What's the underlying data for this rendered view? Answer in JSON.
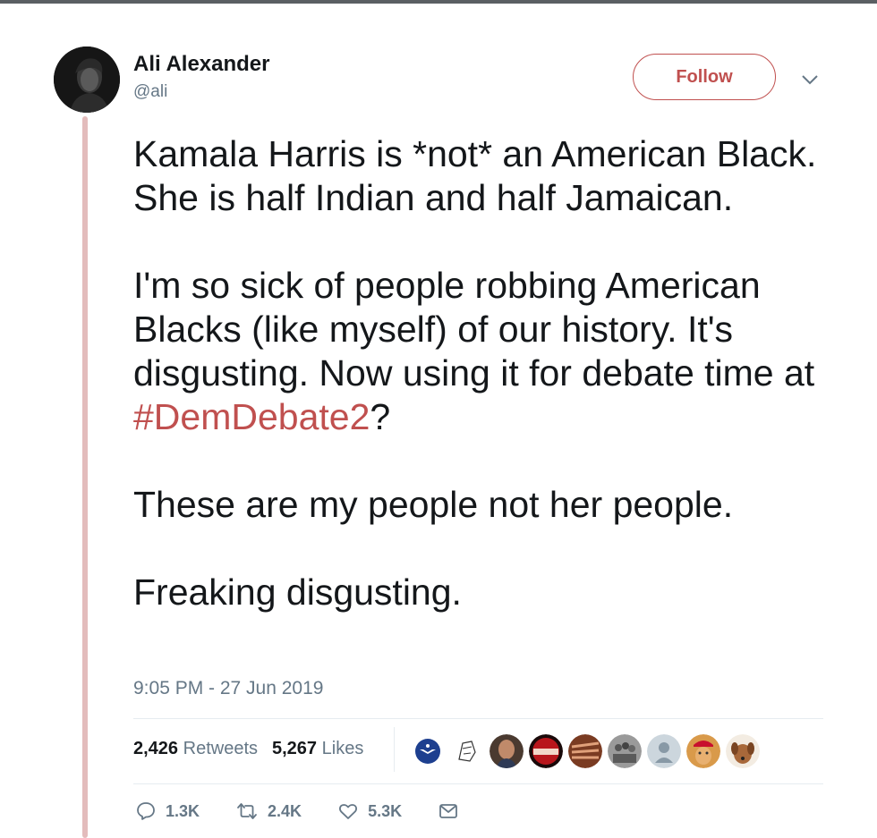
{
  "tweet": {
    "author_name": "Ali Alexander",
    "author_handle": "@ali",
    "follow_label": "Follow",
    "paragraphs": [
      {
        "text": "Kamala Harris is *not* an American Black. She is half Indian and half Jamaican."
      },
      {
        "pre": "I'm so sick of people robbing American Blacks (like myself) of our history. It's disgusting. Now using it for debate time at ",
        "hashtag": "#DemDebate2",
        "post": "?"
      },
      {
        "text": "These are my people not her people."
      },
      {
        "text": "Freaking disgusting."
      }
    ],
    "timestamp": "9:05 PM - 27 Jun 2019",
    "stats": {
      "retweets_count": "2,426",
      "retweets_label": "Retweets",
      "likes_count": "5,267",
      "likes_label": "Likes"
    },
    "liker_avatars": [
      {
        "icon": "air-force-seal-icon",
        "color": "#1d3f8f"
      },
      {
        "icon": "cartoon-sketch-icon",
        "color": "#ffffff"
      },
      {
        "icon": "person-photo-icon",
        "color": "#7a5a46"
      },
      {
        "icon": "sportslife-logo-icon",
        "color": "#b8161c"
      },
      {
        "icon": "pattern-photo-icon",
        "color": "#b4684a"
      },
      {
        "icon": "group-photo-icon",
        "color": "#7d7d7d"
      },
      {
        "icon": "default-avatar-icon",
        "color": "#ccd6dd"
      },
      {
        "icon": "lion-maga-hat-icon",
        "color": "#c98a3a"
      },
      {
        "icon": "dog-photo-icon",
        "color": "#a8683a"
      }
    ],
    "actions": {
      "replies": "1.3K",
      "retweets": "2.4K",
      "likes": "5.3K"
    },
    "colors": {
      "accent": "#c0504f",
      "thread_line": "#e3bcbc",
      "secondary_text": "#657786",
      "primary_text": "#14171a"
    }
  }
}
